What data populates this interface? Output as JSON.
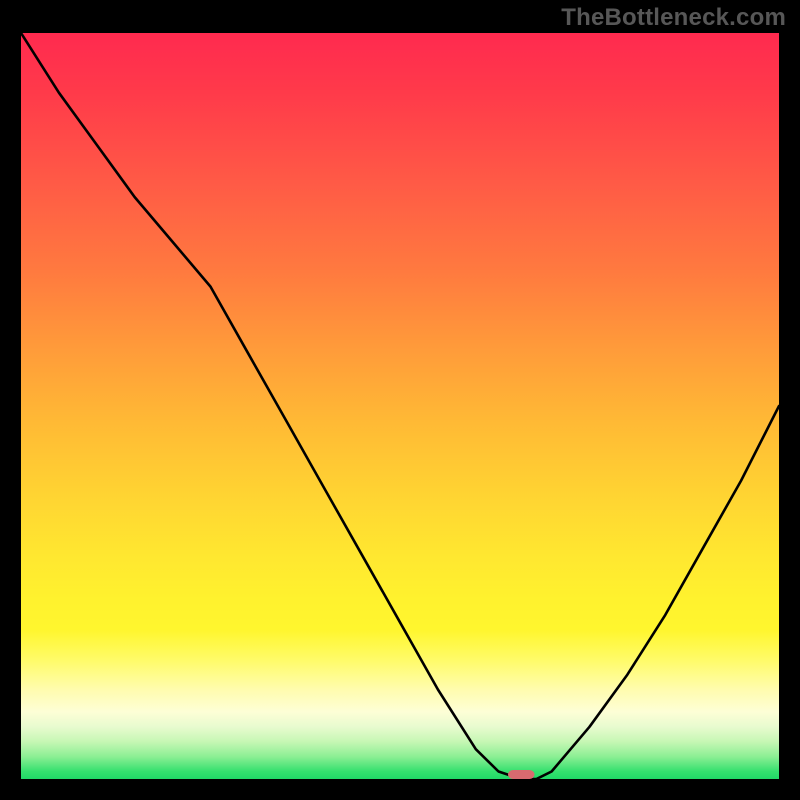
{
  "watermark": "TheBottleneck.com",
  "chart_data": {
    "type": "line",
    "title": "",
    "xlabel": "",
    "ylabel": "",
    "xlim": [
      0,
      100
    ],
    "ylim": [
      0,
      100
    ],
    "grid": false,
    "legend": false,
    "series": [
      {
        "name": "bottleneck-curve",
        "x": [
          0,
          5,
          10,
          15,
          20,
          25,
          30,
          35,
          40,
          45,
          50,
          55,
          60,
          63,
          66,
          68,
          70,
          75,
          80,
          85,
          90,
          95,
          100
        ],
        "y": [
          100,
          92,
          85,
          78,
          72,
          66,
          57,
          48,
          39,
          30,
          21,
          12,
          4,
          1,
          0,
          0,
          1,
          7,
          14,
          22,
          31,
          40,
          50
        ]
      }
    ],
    "marker": {
      "name": "optimal-point",
      "x": 66,
      "y": 0,
      "width_frac": 0.035,
      "height_frac": 0.012,
      "color": "#d86a6f"
    },
    "background_gradient": {
      "stops": [
        {
          "pos": 0.0,
          "color": "#ff2a4f"
        },
        {
          "pos": 0.4,
          "color": "#ff9a3a"
        },
        {
          "pos": 0.75,
          "color": "#fff22e"
        },
        {
          "pos": 0.92,
          "color": "#fdfed6"
        },
        {
          "pos": 1.0,
          "color": "#20d867"
        }
      ]
    }
  }
}
